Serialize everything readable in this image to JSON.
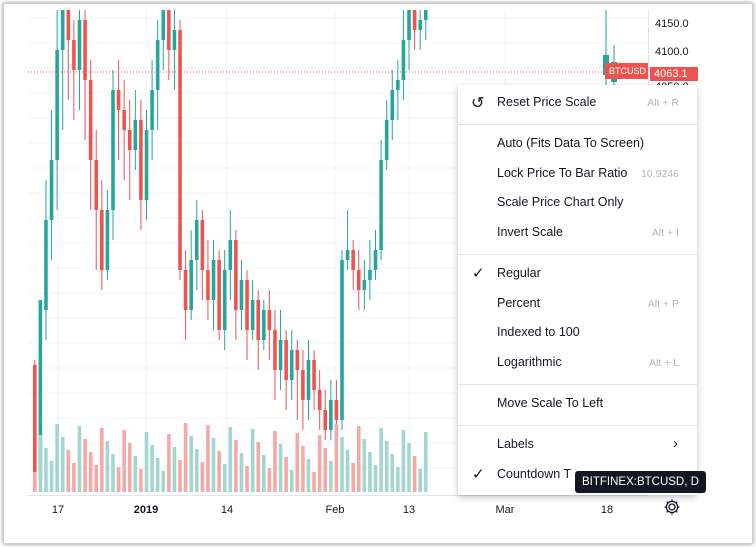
{
  "price_scale": {
    "labels": [
      "4150.0",
      "4100.0"
    ],
    "current_price": "4063.1",
    "current_price_partial": "4050.0",
    "symbol_tag": "BTCUSD"
  },
  "time_scale": {
    "labels": [
      {
        "text": "17",
        "bold": false
      },
      {
        "text": "2019",
        "bold": true
      },
      {
        "text": "14",
        "bold": false
      },
      {
        "text": "Feb",
        "bold": false
      },
      {
        "text": "13",
        "bold": false
      },
      {
        "text": "Mar",
        "bold": false
      },
      {
        "text": "18",
        "bold": false
      }
    ]
  },
  "menu": {
    "reset": {
      "label": "Reset Price Scale",
      "shortcut": "Alt + R"
    },
    "auto": {
      "label": "Auto (Fits Data To Screen)"
    },
    "lock": {
      "label": "Lock Price To Bar Ratio",
      "value": "10.9246"
    },
    "scale_only": {
      "label": "Scale Price Chart Only"
    },
    "invert": {
      "label": "Invert Scale",
      "shortcut": "Alt + I"
    },
    "regular": {
      "label": "Regular"
    },
    "percent": {
      "label": "Percent",
      "shortcut": "Alt + P"
    },
    "indexed": {
      "label": "Indexed to 100"
    },
    "log": {
      "label": "Logarithmic",
      "shortcut": "Alt + L"
    },
    "move_left": {
      "label": "Move Scale To Left"
    },
    "labels": {
      "label": "Labels"
    },
    "countdown": {
      "label": "Countdown T"
    }
  },
  "tooltip": "BITFINEX:BTCUSD, D",
  "icons": {
    "reset": "reset-arrow-icon",
    "gear": "gear-icon",
    "check": "checkmark-icon",
    "chevron": "chevron-right-icon"
  },
  "colors": {
    "up": "#26a69a",
    "down": "#ef5350",
    "up_vol": "#a3d6cf",
    "down_vol": "#f4a9a7"
  }
}
